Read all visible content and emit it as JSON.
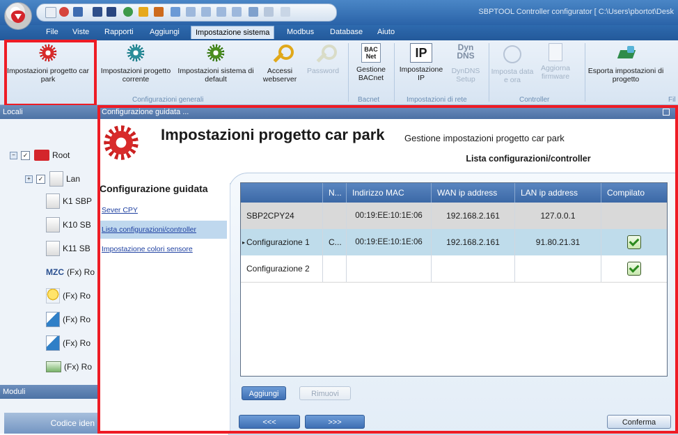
{
  "window": {
    "title": "SBPTOOL Controller configurator [ C:\\Users\\pbortot\\Desk"
  },
  "menu": {
    "tabs": [
      "File",
      "Viste",
      "Rapporti",
      "Aggiungi",
      "Impostazione sistema",
      "Modbus",
      "Database",
      "Aiuto"
    ],
    "active": "Impostazione sistema"
  },
  "ribbon": {
    "buttons": [
      {
        "label": "Impostazioni progetto car park",
        "icon": "gear-red-icon"
      },
      {
        "label": "Impostazioni progetto corrente",
        "icon": "gear-teal-icon"
      },
      {
        "label": "Impostazioni sistema di default",
        "icon": "gear-green-icon"
      },
      {
        "label": "Accessi webserver",
        "icon": "key-icon"
      },
      {
        "label": "Password",
        "icon": "key-disabled-icon"
      },
      {
        "label": "Gestione BACnet",
        "icon": "bacnet-icon"
      },
      {
        "label": "Impostazione IP",
        "icon": "ip-icon"
      },
      {
        "label": "DynDNS Setup",
        "icon": "dyndns-icon"
      },
      {
        "label": "Imposta data e ora",
        "icon": "clock-icon"
      },
      {
        "label": "Aggiorna firmware",
        "icon": "firmware-icon"
      },
      {
        "label": "Esporta impostazioni di progetto",
        "icon": "export-icon"
      }
    ],
    "icon_texts": {
      "bacnet": "BAC Net",
      "ip": "IP",
      "dyndns": "Dyn DNS"
    },
    "groups": [
      "Configurazioni generali",
      "Bacnet",
      "Impostazioni di rete",
      "Controller",
      "Fil"
    ]
  },
  "left_pane": {
    "locali_header": "Locali",
    "tree": [
      {
        "label": "Root"
      },
      {
        "label": "Lan"
      },
      {
        "label": "K1 SBP"
      },
      {
        "label": "K10 SB"
      },
      {
        "label": "K11 SB"
      },
      {
        "label": "(Fx) Ro"
      },
      {
        "label": "(Fx) Ro"
      },
      {
        "label": "(Fx) Ro"
      },
      {
        "label": "(Fx) Ro"
      },
      {
        "label": "(Fx) Ro"
      }
    ],
    "mzc_text": "MZC",
    "moduli_header": "Moduli",
    "bottom_button": "Codice iden"
  },
  "wizard": {
    "window_title": "Configurazione guidata ...",
    "title": "Impostazioni progetto car park",
    "subtitle": "Gestione impostazioni progetto car park",
    "active_tab": "Lista configurazioni/controller",
    "nav_header": "Configurazione guidata",
    "nav_items": [
      "Sever CPY",
      "Lista configurazioni/controller",
      "Impostazione colori sensore"
    ],
    "grid": {
      "columns": [
        "",
        "N...",
        "Indirizzo MAC",
        "WAN ip address",
        "LAN ip address",
        "Compilato"
      ],
      "rows": [
        {
          "name": "SBP2CPY24",
          "n": "",
          "mac": "00:19:EE:10:1E:06",
          "wan": "192.168.2.161",
          "lan": "127.0.0.1",
          "compiled": false
        },
        {
          "name": "Configurazione 1",
          "n": "C...",
          "mac": "00:19:EE:10:1E:06",
          "wan": "192.168.2.161",
          "lan": "91.80.21.31",
          "compiled": true
        },
        {
          "name": "Configurazione 2",
          "n": "",
          "mac": "",
          "wan": "",
          "lan": "",
          "compiled": true
        }
      ]
    },
    "buttons": {
      "add": "Aggiungi",
      "remove": "Rimuovi",
      "prev": "<<<",
      "next": ">>>",
      "confirm": "Conferma"
    }
  }
}
